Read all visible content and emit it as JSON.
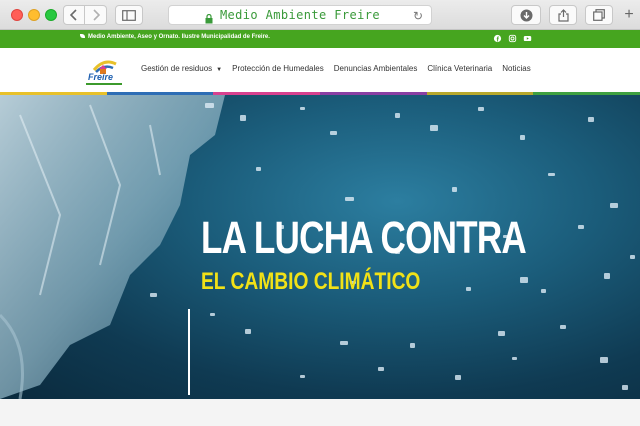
{
  "browser": {
    "url_display": "Medio Ambiente Freire",
    "icons": [
      "back-icon",
      "forward-icon",
      "sidebar-icon",
      "lock-icon",
      "reload-icon",
      "download-icon",
      "share-icon",
      "tabs-icon",
      "new-tab-icon"
    ]
  },
  "topbar": {
    "message": "Medio Ambiente, Aseo y Ornato. Ilustre Municipalidad de Freire.",
    "color": "#46a51f",
    "social_icons": [
      "facebook-icon",
      "instagram-icon",
      "youtube-icon"
    ]
  },
  "header": {
    "logo_text": "Freire",
    "nav": [
      {
        "label": "Gestión de residuos",
        "has_dropdown": true
      },
      {
        "label": "Protección de Humedales"
      },
      {
        "label": "Denuncias Ambientales"
      },
      {
        "label": "Clínica Veterinaria"
      },
      {
        "label": "Noticias"
      }
    ],
    "stripe_colors": [
      "#e8c12a",
      "#2d6db5",
      "#d8418f",
      "#8a3fa3",
      "#b7a82c",
      "#3fa040"
    ]
  },
  "hero": {
    "title": "LA LUCHA CONTRA",
    "subtitle": "EL CAMBIO CLIMÁTICO",
    "title_color": "#ffffff",
    "subtitle_color": "#f1e117"
  }
}
